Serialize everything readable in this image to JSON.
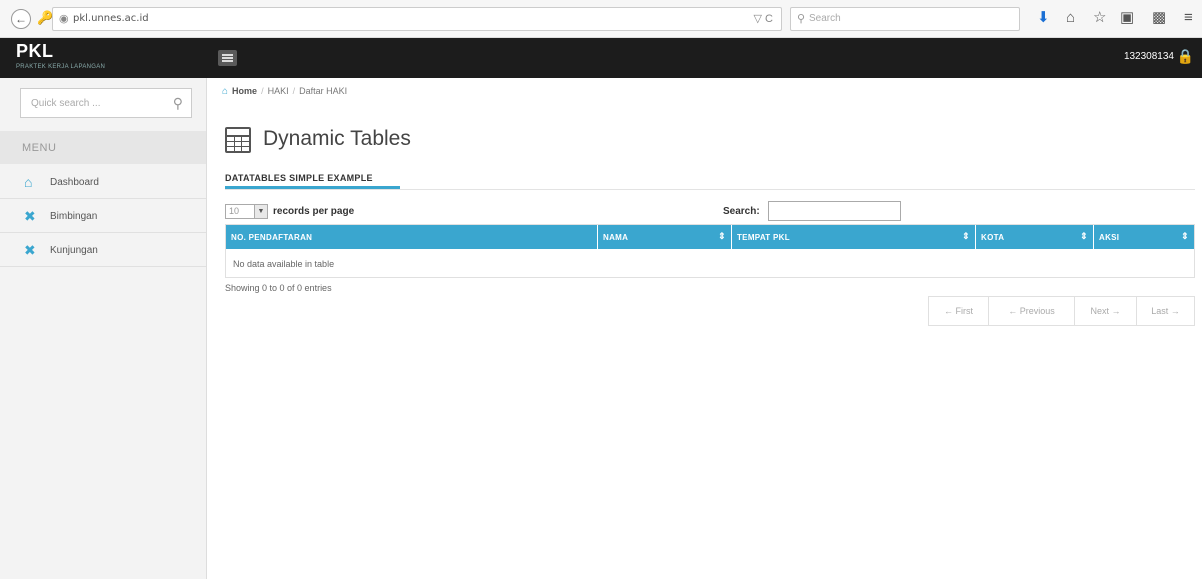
{
  "browser": {
    "url": "pkl.unnes.ac.id",
    "search_placeholder": "Search",
    "url_controls": "▽ C",
    "icons": [
      "back-arrow-icon",
      "key-icon",
      "globe-icon",
      "reload-icon",
      "download-icon",
      "home-icon",
      "bookmark-star-icon",
      "clipboard-icon",
      "extension-icon",
      "hamburger-menu-icon"
    ]
  },
  "header": {
    "brand_title": "PKL",
    "brand_subtitle": "PRAKTEK KERJA LAPANGAN",
    "user_id": "132308134"
  },
  "sidebar": {
    "search_placeholder": "Quick search ...",
    "menu_header": "MENU",
    "items": [
      {
        "label": "Dashboard",
        "icon": "home-icon"
      },
      {
        "label": "Bimbingan",
        "icon": "tools-icon"
      },
      {
        "label": "Kunjungan",
        "icon": "tools-icon"
      }
    ]
  },
  "breadcrumb": {
    "home": "Home",
    "items": [
      "HAKI",
      "Daftar HAKI"
    ]
  },
  "page": {
    "title": "Dynamic Tables",
    "section_title": "DATATABLES SIMPLE EXAMPLE"
  },
  "table_controls": {
    "length_value": "10",
    "length_label": "records per page",
    "filter_label": "Search:"
  },
  "table": {
    "columns": [
      "NO. PENDAFTARAN",
      "NAMA",
      "TEMPAT PKL",
      "KOTA",
      "AKSI"
    ],
    "empty_message": "No data available in table",
    "info": "Showing 0 to 0 of 0 entries"
  },
  "pagination": {
    "first": "← First",
    "previous": "← Previous",
    "next": "Next →",
    "last": "Last →"
  },
  "colors": {
    "accent": "#3aa6cf",
    "topbar": "#1c1c1c",
    "sidebar": "#f3f3f3",
    "lock": "#f2b632"
  }
}
